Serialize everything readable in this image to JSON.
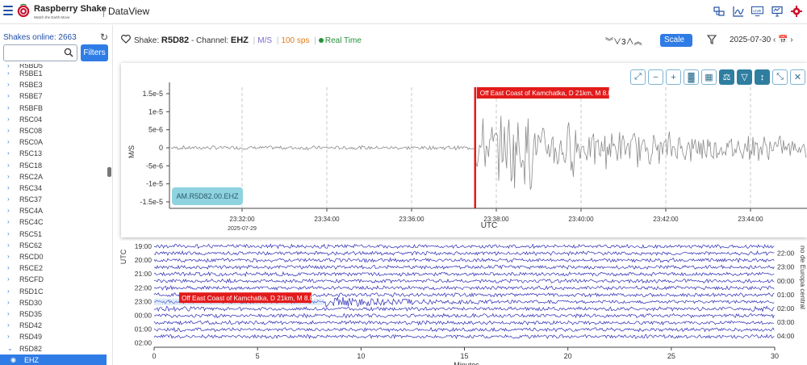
{
  "header": {
    "brand": "Raspberry Shake",
    "tagline": "Watch the Earth Move",
    "app_name": "DataView",
    "icons": [
      "map-compare-icon",
      "chart-icon",
      "live-icon",
      "monitor-icon",
      "settings-gear-icon"
    ],
    "live_label": "LIVE"
  },
  "sidebar": {
    "online_text": "Shakes online: 2663",
    "search_placeholder": "",
    "filters_label": "Filters",
    "partial_item": "R5BD5",
    "items": [
      "R5BE1",
      "R5BE3",
      "R5BE7",
      "R5BFB",
      "R5C04",
      "R5C08",
      "R5C0A",
      "R5C13",
      "R5C18",
      "R5C2A",
      "R5C34",
      "R5C37",
      "R5C4A",
      "R5C4C",
      "R5C51",
      "R5C62",
      "R5CD0",
      "R5CE2",
      "R5CFD",
      "R5D1C",
      "R5D30",
      "R5D35",
      "R5D42",
      "R5D49"
    ],
    "expanded_item": "R5D82",
    "selected_channel": "EHZ"
  },
  "toolbar": {
    "shake_prefix": "Shake:",
    "shake_id": "R5D82",
    "channel_prefix": "- Channel:",
    "channel": "EHZ",
    "units": "M/S",
    "sps": "100 sps",
    "realtime": "Real Time",
    "zoom_value": "3",
    "scale_label": "Scale",
    "date": "2025-07-30"
  },
  "waveform_chart": {
    "type": "line",
    "station_label": "AM.R5D82.00.EHZ",
    "ylabel": "M/S",
    "xlabel": "UTC",
    "yticks": [
      "1.5e-5",
      "1e-5",
      "5e-6",
      "0",
      "-5e-6",
      "-1e-5",
      "-1.5e-5"
    ],
    "xticks": [
      "23:32:00",
      "23:34:00",
      "23:36:00",
      "23:38:00",
      "23:40:00",
      "23:42:00",
      "23:44:00"
    ],
    "date_label": "2025-07-29",
    "event_label": "Off East Coast of Kamchatka, D 21km, M 8.8",
    "event_time": "23:37:30",
    "accent": "#e31b1b"
  },
  "heli_chart": {
    "type": "line",
    "left_label": "UTC",
    "right_label": "no de Europa central",
    "xlabel": "Minutos",
    "xticks": [
      "0",
      "5",
      "10",
      "15",
      "20",
      "25",
      "30"
    ],
    "left_times": [
      "19:00",
      "20:00",
      "21:00",
      "22:00",
      "23:00",
      "00:00",
      "01:00",
      "02:00"
    ],
    "right_times": [
      "22:00",
      "23:00",
      "00:00",
      "01:00",
      "02:00",
      "03:00",
      "04:00"
    ],
    "event_label": "Off East Coast of Kamchatka, D 21km, M 8.8",
    "trace_color": "#2b2bb5"
  },
  "chart_tools": [
    "zoom-extent-icon",
    "zoom-out-icon",
    "zoom-in-icon",
    "spectrum-icon",
    "grid-icon",
    "scale-balance-icon",
    "filter-icon",
    "vertical-arrows-icon",
    "expand-icon",
    "close-icon"
  ]
}
